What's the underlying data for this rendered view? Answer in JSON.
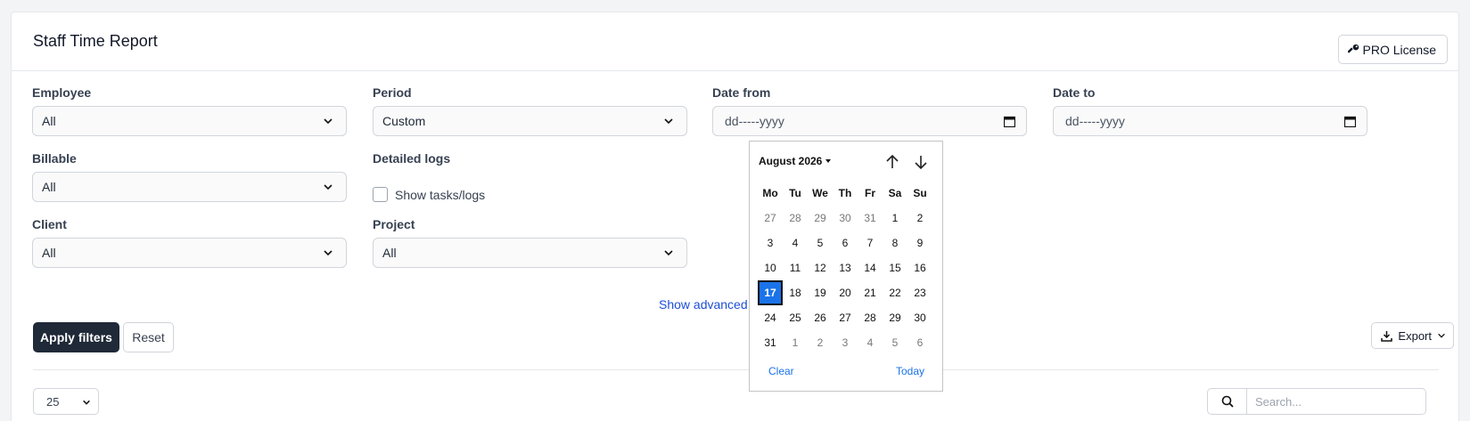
{
  "header": {
    "title": "Staff Time Report",
    "pro_label": "PRO License"
  },
  "filters": {
    "employee": {
      "label": "Employee",
      "value": "All"
    },
    "period": {
      "label": "Period",
      "value": "Custom"
    },
    "date_from": {
      "label": "Date from",
      "placeholder": "dd-----yyyy"
    },
    "date_to": {
      "label": "Date to",
      "placeholder": "dd-----yyyy"
    },
    "billable": {
      "label": "Billable",
      "value": "All"
    },
    "detailed_logs": {
      "label": "Detailed logs",
      "checkbox_label": "Show tasks/logs",
      "checked": false
    },
    "client": {
      "label": "Client",
      "value": "All"
    },
    "project": {
      "label": "Project",
      "value": "All"
    },
    "advanced_link": "Show advanced"
  },
  "actions": {
    "apply": "Apply filters",
    "reset": "Reset",
    "export": "Export"
  },
  "table_controls": {
    "page_size": "25",
    "search_placeholder": "Search..."
  },
  "calendar": {
    "month_label": "August 2026",
    "weekdays": [
      "Mo",
      "Tu",
      "We",
      "Th",
      "Fr",
      "Sa",
      "Su"
    ],
    "days": [
      [
        "27",
        "28",
        "29",
        "30",
        "31",
        "1",
        "2"
      ],
      [
        "3",
        "4",
        "5",
        "6",
        "7",
        "8",
        "9"
      ],
      [
        "10",
        "11",
        "12",
        "13",
        "14",
        "15",
        "16"
      ],
      [
        "17",
        "18",
        "19",
        "20",
        "21",
        "22",
        "23"
      ],
      [
        "24",
        "25",
        "26",
        "27",
        "28",
        "29",
        "30"
      ],
      [
        "31",
        "1",
        "2",
        "3",
        "4",
        "5",
        "6"
      ]
    ],
    "selected": "17",
    "clear": "Clear",
    "today": "Today"
  },
  "colors": {
    "primary_dark": "#1f2937",
    "link": "#1d4ed8",
    "calendar_selected": "#1a73e8"
  }
}
